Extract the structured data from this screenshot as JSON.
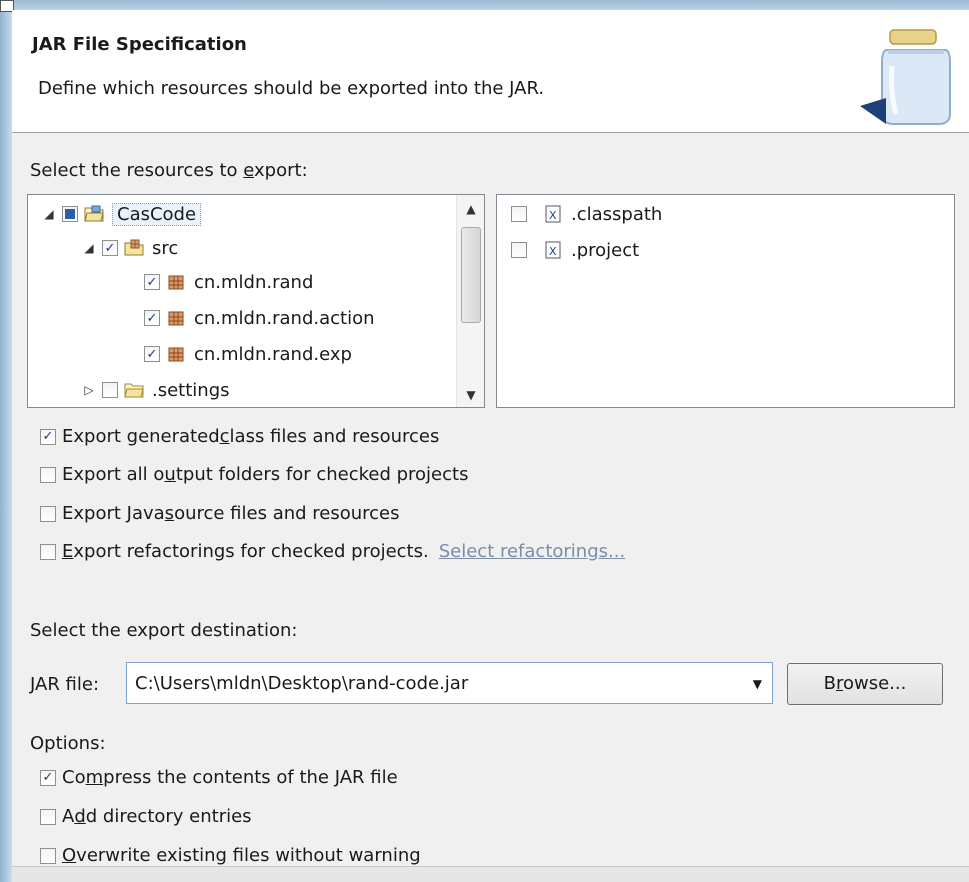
{
  "header": {
    "title": "JAR File Specification",
    "description": "Define which resources should be exported into the JAR."
  },
  "resources": {
    "label_pre": "Select the resources to ",
    "label_mnemonic": "e",
    "label_post": "xport:",
    "tree": [
      {
        "label": "CasCode",
        "level": 0,
        "expanded": true,
        "check": "partial",
        "icon": "project-folder-icon"
      },
      {
        "label": "src",
        "level": 1,
        "expanded": true,
        "check": "checked",
        "icon": "source-folder-icon"
      },
      {
        "label": "cn.mldn.rand",
        "level": 2,
        "check": "checked",
        "icon": "package-icon"
      },
      {
        "label": "cn.mldn.rand.action",
        "level": 2,
        "check": "checked",
        "icon": "package-icon"
      },
      {
        "label": "cn.mldn.rand.exp",
        "level": 2,
        "check": "checked",
        "icon": "package-icon"
      },
      {
        "label": ".settings",
        "level": 1,
        "expanded": false,
        "check": "unchecked",
        "icon": "folder-icon"
      }
    ],
    "files": [
      {
        "label": ".classpath",
        "check": "unchecked",
        "icon": "xml-file-icon"
      },
      {
        "label": ".project",
        "check": "unchecked",
        "icon": "xml-file-icon"
      }
    ]
  },
  "export_options": {
    "generated_pre": "Export generated ",
    "generated_mn": "c",
    "generated_post": "lass files and resources",
    "generated_checked": true,
    "output_pre": "Export all o",
    "output_mn": "u",
    "output_post": "tput folders for checked projects",
    "source_pre": "Export Java ",
    "source_mn": "s",
    "source_post": "ource files and resources",
    "refactor_mn": "E",
    "refactor_post": "xport refactorings for checked projects.",
    "refactor_link": "Select refactorings..."
  },
  "destination": {
    "label": "Select the export destination:",
    "jar_label_mn": "J",
    "jar_label_post": "AR file:",
    "jar_path": "C:\\Users\\mldn\\Desktop\\rand-code.jar",
    "browse_pre": "B",
    "browse_mn": "r",
    "browse_post": "owse..."
  },
  "options": {
    "label": "Options:",
    "compress_pre": "Co",
    "compress_mn": "m",
    "compress_post": "press the contents of the JAR file",
    "compress_checked": true,
    "dir_pre": "A",
    "dir_mn": "d",
    "dir_post": "d directory entries",
    "overwrite_mn": "O",
    "overwrite_post": "verwrite existing files without warning"
  },
  "colors": {
    "header_bg": "#ffffff",
    "dialog_bg": "#f0f0f0",
    "check_color": "#1a3f7a",
    "link_color": "#7a8ea6"
  }
}
